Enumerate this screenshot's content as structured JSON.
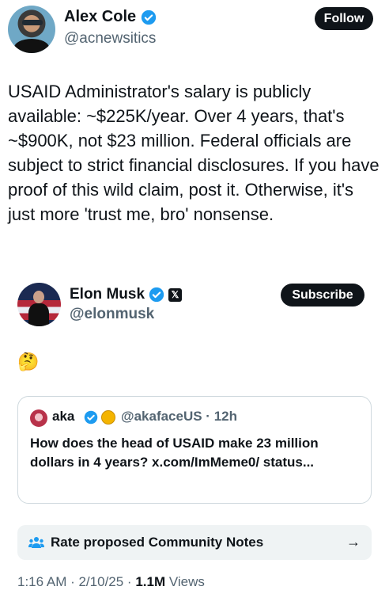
{
  "post": {
    "author_name": "Alex Cole",
    "author_handle": "@acnewsitics",
    "follow_label": "Follow",
    "text": "USAID Administrator's salary is publicly available: ~$225K/year. Over 4 years, that's ~$900K, not $23 million. Federal officials are subject to strict financial disclosures. If you have proof of this wild claim, post it. Otherwise, it's just more 'trust me, bro' nonsense."
  },
  "reply": {
    "author_name": "Elon Musk",
    "author_handle": "@elonmusk",
    "subscribe_label": "Subscribe",
    "emoji": "🤔",
    "x_badge": "𝕏"
  },
  "quote": {
    "author_name": "aka",
    "author_handle": "@akafaceUS · 12h",
    "text": "How does the head of USAID make 23 million dollars in 4 years? x.com/ImMeme0/ status..."
  },
  "community_notes": {
    "label": "Rate proposed Community Notes",
    "arrow": "→"
  },
  "meta": {
    "timestamp": "1:16 AM · 2/10/25 · ",
    "views_count": "1.1M",
    "views_label": " Views"
  },
  "colors": {
    "verified_blue": "#1d9bf0",
    "text_primary": "#0f1419",
    "text_secondary": "#536471",
    "border": "#cfd9de"
  },
  "icons": [
    "verified-badge-icon",
    "x-logo-icon",
    "gold-badge-icon",
    "people-icon",
    "arrow-right-icon"
  ]
}
